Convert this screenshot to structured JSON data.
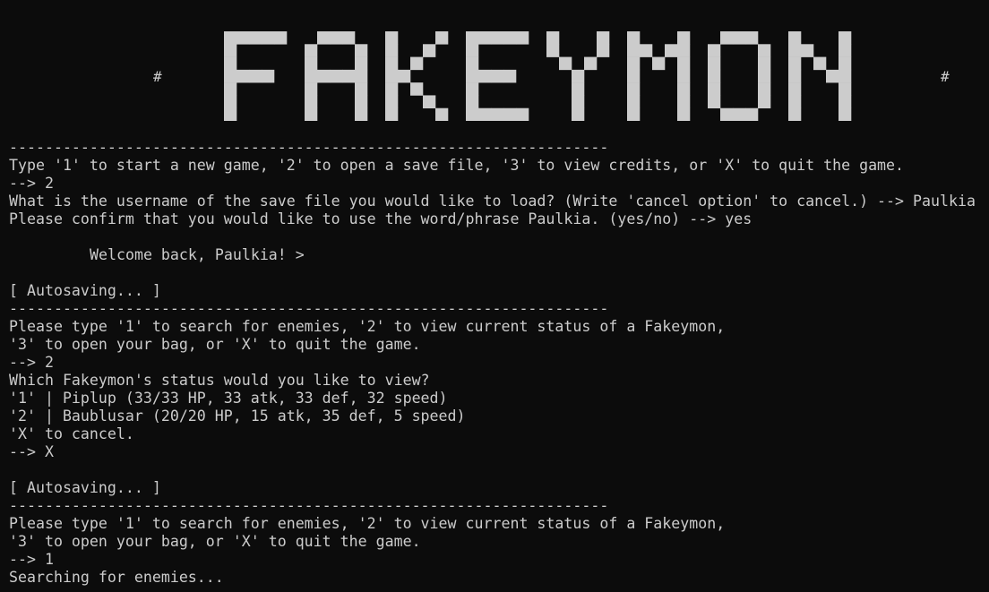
{
  "logo": {
    "text": "FAKEYMON",
    "hash_left": "#",
    "hash_right": "#",
    "color": "#cccccc"
  },
  "colors": {
    "background": "#0c0c0c",
    "foreground": "#cccccc"
  },
  "lines": [
    {
      "type": "text",
      "text": "-------------------------------------------------------------------"
    },
    {
      "type": "text",
      "text": "Type '1' to start a new game, '2' to open a save file, '3' to view credits, or 'X' to quit the game."
    },
    {
      "type": "text",
      "text": "--> 2"
    },
    {
      "type": "text",
      "text": "What is the username of the save file you would like to load? (Write 'cancel option' to cancel.) --> Paulkia"
    },
    {
      "type": "text",
      "text": "Please confirm that you would like to use the word/phrase Paulkia. (yes/no) --> yes"
    },
    {
      "type": "empty",
      "text": ""
    },
    {
      "type": "indent",
      "text": "Welcome back, Paulkia! >"
    },
    {
      "type": "empty",
      "text": ""
    },
    {
      "type": "text",
      "text": "[ Autosaving... ]"
    },
    {
      "type": "text",
      "text": "-------------------------------------------------------------------"
    },
    {
      "type": "text",
      "text": "Please type '1' to search for enemies, '2' to view current status of a Fakeymon,"
    },
    {
      "type": "text",
      "text": "'3' to open your bag, or 'X' to quit the game."
    },
    {
      "type": "text",
      "text": "--> 2"
    },
    {
      "type": "text",
      "text": "Which Fakeymon's status would you like to view?"
    },
    {
      "type": "text",
      "text": "'1' | Piplup (33/33 HP, 33 atk, 33 def, 32 speed)"
    },
    {
      "type": "text",
      "text": "'2' | Baublusar (20/20 HP, 15 atk, 35 def, 5 speed)"
    },
    {
      "type": "text",
      "text": "'X' to cancel."
    },
    {
      "type": "text",
      "text": "--> X"
    },
    {
      "type": "empty",
      "text": ""
    },
    {
      "type": "text",
      "text": "[ Autosaving... ]"
    },
    {
      "type": "text",
      "text": "-------------------------------------------------------------------"
    },
    {
      "type": "text",
      "text": "Please type '1' to search for enemies, '2' to view current status of a Fakeymon,"
    },
    {
      "type": "text",
      "text": "'3' to open your bag, or 'X' to quit the game."
    },
    {
      "type": "text",
      "text": "--> 1"
    },
    {
      "type": "text",
      "text": "Searching for enemies..."
    }
  ]
}
